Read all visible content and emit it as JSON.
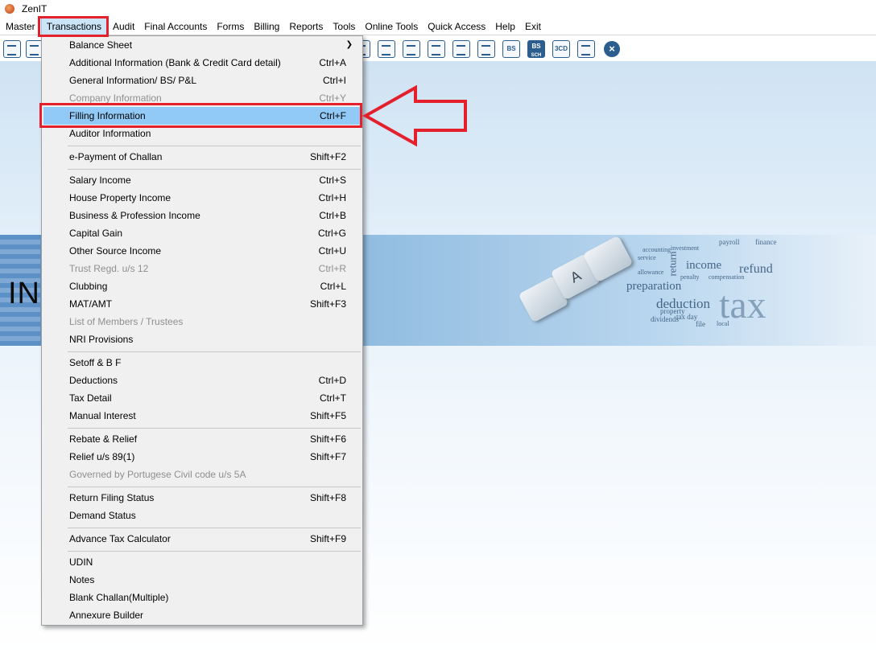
{
  "window": {
    "title": "ZenIT"
  },
  "menubar": {
    "items": [
      "Master",
      "Transactions",
      "Audit",
      "Final Accounts",
      "Forms",
      "Billing",
      "Reports",
      "Tools",
      "Online Tools",
      "Quick Access",
      "Help",
      "Exit"
    ],
    "open_item": "Transactions"
  },
  "toolbar": {
    "icons": [
      "rupee-icon",
      "home-icon",
      "search-icon",
      "chart-icon",
      "user-doc-icon",
      "calendar-icon",
      "folder-add-icon",
      "refresh-icon",
      "bs-icon",
      "bs-sch-icon",
      "3cd-icon",
      "form-icon",
      "close-icon"
    ],
    "bs_label": "BS",
    "bs_sch_label": "BS",
    "bs_sch_sub": "SCH",
    "cd_label": "3CD"
  },
  "banner": {
    "left_text": "INC",
    "words": [
      "payroll",
      "investment",
      "finance",
      "accounting",
      "service",
      "income",
      "refund",
      "preparation",
      "deduction",
      "tax",
      "penalty",
      "compensation",
      "allowance",
      "return",
      "dividends",
      "property",
      "tax day",
      "local",
      "file"
    ]
  },
  "transactions_menu": {
    "items": [
      {
        "label": "Balance Sheet",
        "shortcut": "",
        "disabled": false,
        "submenu": true
      },
      {
        "label": "Additional Information (Bank & Credit Card detail)",
        "shortcut": "Ctrl+A",
        "disabled": false
      },
      {
        "label": "General Information/ BS/ P&L",
        "shortcut": "Ctrl+I",
        "disabled": false
      },
      {
        "label": "Company Information",
        "shortcut": "Ctrl+Y",
        "disabled": true
      },
      {
        "label": "Filling Information",
        "shortcut": "Ctrl+F",
        "disabled": false,
        "selected": true
      },
      {
        "label": "Auditor Information",
        "shortcut": "",
        "disabled": false
      },
      {
        "label": "e-Payment of Challan",
        "shortcut": "Shift+F2",
        "disabled": false
      },
      {
        "label": "Salary Income",
        "shortcut": "Ctrl+S",
        "disabled": false
      },
      {
        "label": "House Property Income",
        "shortcut": "Ctrl+H",
        "disabled": false
      },
      {
        "label": "Business & Profession Income",
        "shortcut": "Ctrl+B",
        "disabled": false
      },
      {
        "label": "Capital Gain",
        "shortcut": "Ctrl+G",
        "disabled": false
      },
      {
        "label": "Other Source Income",
        "shortcut": "Ctrl+U",
        "disabled": false
      },
      {
        "label": "Trust Regd. u/s 12",
        "shortcut": "Ctrl+R",
        "disabled": true
      },
      {
        "label": "Clubbing",
        "shortcut": "Ctrl+L",
        "disabled": false
      },
      {
        "label": "MAT/AMT",
        "shortcut": "Shift+F3",
        "disabled": false
      },
      {
        "label": "List of Members / Trustees",
        "shortcut": "",
        "disabled": true
      },
      {
        "label": "NRI Provisions",
        "shortcut": "",
        "disabled": false
      },
      {
        "label": "Setoff & B F",
        "shortcut": "",
        "disabled": false
      },
      {
        "label": "Deductions",
        "shortcut": "Ctrl+D",
        "disabled": false
      },
      {
        "label": "Tax Detail",
        "shortcut": "Ctrl+T",
        "disabled": false
      },
      {
        "label": "Manual Interest",
        "shortcut": "Shift+F5",
        "disabled": false
      },
      {
        "label": "Rebate & Relief",
        "shortcut": "Shift+F6",
        "disabled": false
      },
      {
        "label": "Relief u/s 89(1)",
        "shortcut": "Shift+F7",
        "disabled": false
      },
      {
        "label": "Governed by Portugese Civil code u/s 5A",
        "shortcut": "",
        "disabled": true
      },
      {
        "label": "Return Filing Status",
        "shortcut": "Shift+F8",
        "disabled": false
      },
      {
        "label": "Demand Status",
        "shortcut": "",
        "disabled": false
      },
      {
        "label": "Advance Tax Calculator",
        "shortcut": "Shift+F9",
        "disabled": false
      },
      {
        "label": "UDIN",
        "shortcut": "",
        "disabled": false
      },
      {
        "label": "Notes",
        "shortcut": "",
        "disabled": false
      },
      {
        "label": "Blank Challan(Multiple)",
        "shortcut": "",
        "disabled": false
      },
      {
        "label": "Annexure Builder",
        "shortcut": "",
        "disabled": false
      }
    ]
  },
  "colors": {
    "highlight": "#e3202c",
    "selected_row": "#91c9f7",
    "menu_bg": "#f0f0f0",
    "toolbar_icon": "#2c5d8f"
  }
}
